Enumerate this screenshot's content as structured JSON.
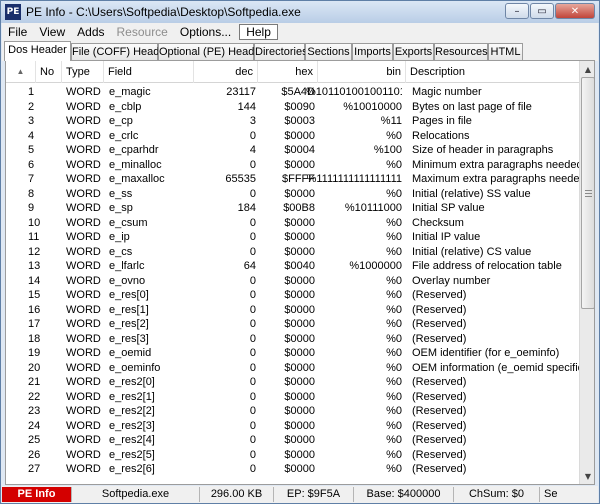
{
  "window": {
    "title": "PE Info - C:\\Users\\Softpedia\\Desktop\\Softpedia.exe",
    "app_icon_text": "PE"
  },
  "window_buttons": {
    "minimize": "–",
    "maximize": "▭",
    "close": "✕"
  },
  "menu": [
    {
      "label": "File",
      "disabled": false,
      "boxed": false
    },
    {
      "label": "View",
      "disabled": false,
      "boxed": false
    },
    {
      "label": "Adds",
      "disabled": false,
      "boxed": false
    },
    {
      "label": "Resource",
      "disabled": true,
      "boxed": false
    },
    {
      "label": "Options...",
      "disabled": false,
      "boxed": false
    },
    {
      "label": "Help",
      "disabled": false,
      "boxed": true
    }
  ],
  "tabs": [
    {
      "label": "Dos Header",
      "active": true
    },
    {
      "label": "File (COFF) Header",
      "active": false
    },
    {
      "label": "Optional (PE) Header",
      "active": false
    },
    {
      "label": "Directories",
      "active": false
    },
    {
      "label": "Sections",
      "active": false
    },
    {
      "label": "Imports",
      "active": false
    },
    {
      "label": "Exports",
      "active": false
    },
    {
      "label": "Resources",
      "active": false
    },
    {
      "label": "HTML",
      "active": false
    }
  ],
  "columns": {
    "sort_indicator": "▲",
    "no": "No",
    "type": "Type",
    "field": "Field",
    "dec": "dec",
    "hex": "hex",
    "bin": "bin",
    "description": "Description"
  },
  "rows": [
    [
      "1",
      "WORD",
      "e_magic",
      "23117",
      "$5A4D",
      "%101101001001101",
      "Magic number"
    ],
    [
      "2",
      "WORD",
      "e_cblp",
      "144",
      "$0090",
      "%10010000",
      "Bytes on last page of file"
    ],
    [
      "3",
      "WORD",
      "e_cp",
      "3",
      "$0003",
      "%11",
      "Pages in file"
    ],
    [
      "4",
      "WORD",
      "e_crlc",
      "0",
      "$0000",
      "%0",
      "Relocations"
    ],
    [
      "5",
      "WORD",
      "e_cparhdr",
      "4",
      "$0004",
      "%100",
      "Size of header in paragraphs"
    ],
    [
      "6",
      "WORD",
      "e_minalloc",
      "0",
      "$0000",
      "%0",
      "Minimum extra paragraphs needed"
    ],
    [
      "7",
      "WORD",
      "e_maxalloc",
      "65535",
      "$FFFF",
      "%1111111111111111",
      "Maximum extra paragraphs needed"
    ],
    [
      "8",
      "WORD",
      "e_ss",
      "0",
      "$0000",
      "%0",
      "Initial (relative) SS value"
    ],
    [
      "9",
      "WORD",
      "e_sp",
      "184",
      "$00B8",
      "%10111000",
      "Initial SP value"
    ],
    [
      "10",
      "WORD",
      "e_csum",
      "0",
      "$0000",
      "%0",
      "Checksum"
    ],
    [
      "11",
      "WORD",
      "e_ip",
      "0",
      "$0000",
      "%0",
      "Initial IP value"
    ],
    [
      "12",
      "WORD",
      "e_cs",
      "0",
      "$0000",
      "%0",
      "Initial (relative) CS value"
    ],
    [
      "13",
      "WORD",
      "e_lfarlc",
      "64",
      "$0040",
      "%1000000",
      "File address of relocation table"
    ],
    [
      "14",
      "WORD",
      "e_ovno",
      "0",
      "$0000",
      "%0",
      "Overlay number"
    ],
    [
      "15",
      "WORD",
      "e_res[0]",
      "0",
      "$0000",
      "%0",
      "(Reserved)"
    ],
    [
      "16",
      "WORD",
      "e_res[1]",
      "0",
      "$0000",
      "%0",
      "(Reserved)"
    ],
    [
      "17",
      "WORD",
      "e_res[2]",
      "0",
      "$0000",
      "%0",
      "(Reserved)"
    ],
    [
      "18",
      "WORD",
      "e_res[3]",
      "0",
      "$0000",
      "%0",
      "(Reserved)"
    ],
    [
      "19",
      "WORD",
      "e_oemid",
      "0",
      "$0000",
      "%0",
      "OEM identifier (for e_oeminfo)"
    ],
    [
      "20",
      "WORD",
      "e_oeminfo",
      "0",
      "$0000",
      "%0",
      "OEM information (e_oemid specific)"
    ],
    [
      "21",
      "WORD",
      "e_res2[0]",
      "0",
      "$0000",
      "%0",
      "(Reserved)"
    ],
    [
      "22",
      "WORD",
      "e_res2[1]",
      "0",
      "$0000",
      "%0",
      "(Reserved)"
    ],
    [
      "23",
      "WORD",
      "e_res2[2]",
      "0",
      "$0000",
      "%0",
      "(Reserved)"
    ],
    [
      "24",
      "WORD",
      "e_res2[3]",
      "0",
      "$0000",
      "%0",
      "(Reserved)"
    ],
    [
      "25",
      "WORD",
      "e_res2[4]",
      "0",
      "$0000",
      "%0",
      "(Reserved)"
    ],
    [
      "26",
      "WORD",
      "e_res2[5]",
      "0",
      "$0000",
      "%0",
      "(Reserved)"
    ],
    [
      "27",
      "WORD",
      "e_res2[6]",
      "0",
      "$0000",
      "%0",
      "(Reserved)"
    ]
  ],
  "status": {
    "app_label": "PE Info",
    "file": "Softpedia.exe",
    "size": "296.00 KB",
    "ep": "EP: $9F5A",
    "base": "Base: $400000",
    "chsum": "ChSum: $0",
    "extra": "Se"
  },
  "colors": {
    "status_red": "#d40000",
    "title_bar_top": "#dbe7f5",
    "title_bar_bottom": "#b9cde6"
  }
}
